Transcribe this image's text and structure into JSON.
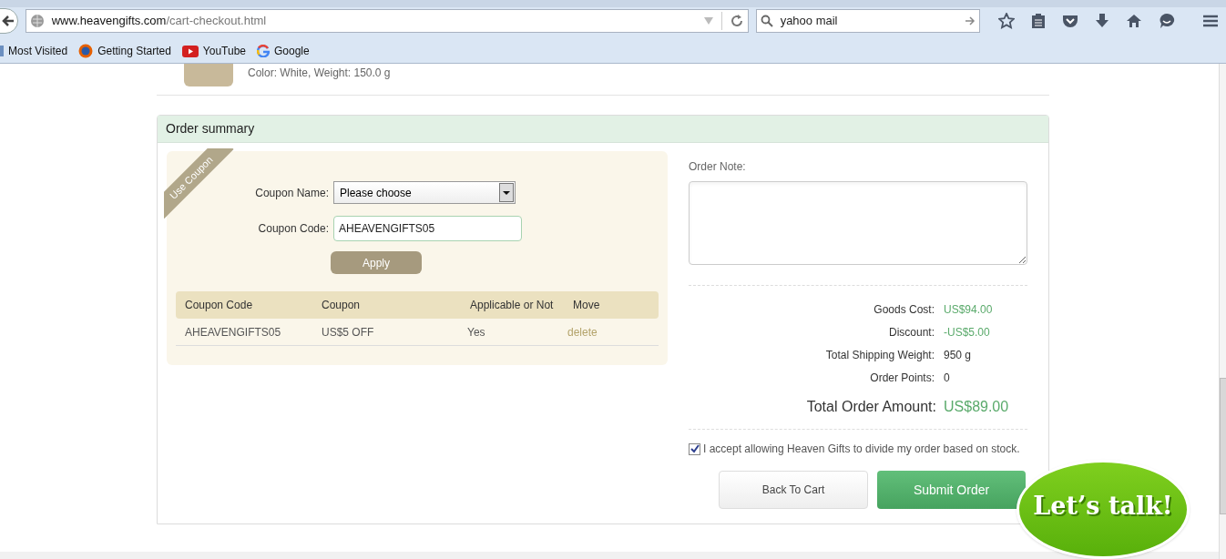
{
  "browser": {
    "url_host": "www.heavengifts.com",
    "url_path": "/cart-checkout.html",
    "search_value": "yahoo mail",
    "bookmarks": [
      {
        "label": "Most Visited",
        "kind": "folder"
      },
      {
        "label": "Getting Started",
        "kind": "firefox"
      },
      {
        "label": "YouTube",
        "kind": "youtube"
      },
      {
        "label": "Google",
        "kind": "google"
      }
    ]
  },
  "product": {
    "details": "Color: White, Weight: 150.0 g"
  },
  "order_summary": {
    "title": "Order summary",
    "coupon": {
      "ribbon": "Use Coupon",
      "name_label": "Coupon Name:",
      "name_value": "Please choose",
      "code_label": "Coupon Code:",
      "code_value": "AHEAVENGIFTS05",
      "apply": "Apply",
      "table": {
        "columns": [
          "Coupon Code",
          "Coupon",
          "Applicable or Not",
          "Move"
        ],
        "rows": [
          [
            "AHEAVENGIFTS05",
            "US$5 OFF",
            "Yes",
            "delete"
          ]
        ]
      }
    },
    "note_label": "Order Note:",
    "totals": [
      {
        "label": "Goods Cost:",
        "value": "US$94.00",
        "kind": "money"
      },
      {
        "label": "Discount:",
        "value": "-US$5.00",
        "kind": "money"
      },
      {
        "label": "Total Shipping Weight:",
        "value": "950 g",
        "kind": "plain"
      },
      {
        "label": "Order Points:",
        "value": "0",
        "kind": "plain"
      }
    ],
    "total": {
      "label": "Total Order Amount:",
      "value": "US$89.00"
    },
    "agreement": {
      "text": "I accept allowing Heaven Gifts to divide my order based on stock.",
      "checked": true
    },
    "back_button": "Back To Cart",
    "submit_button": "Submit Order"
  },
  "chat_bubble": "Let’s talk!"
}
